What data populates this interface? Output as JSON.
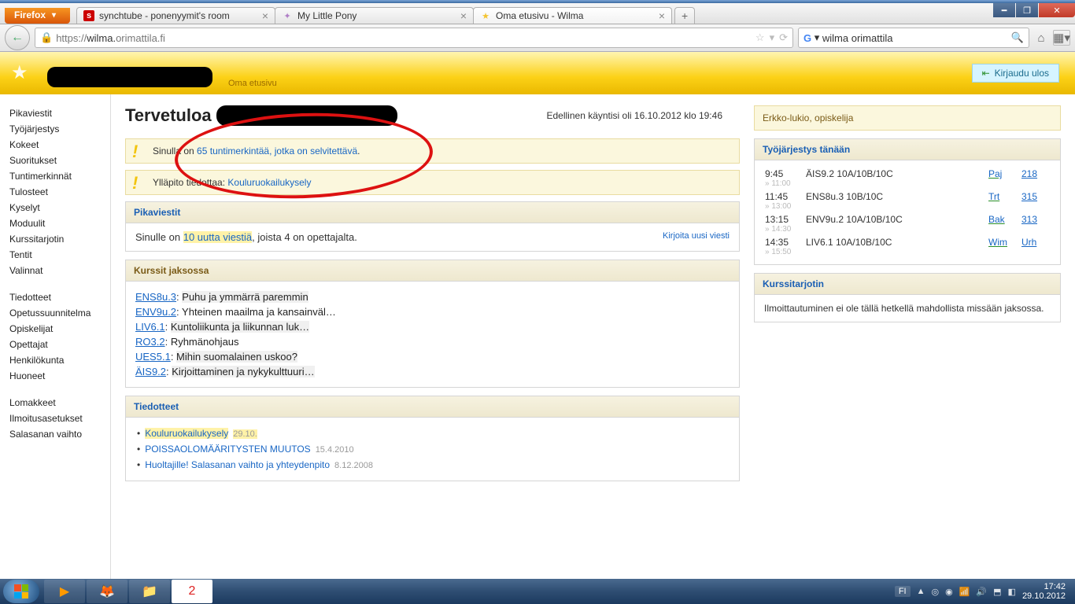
{
  "browser": {
    "name": "Firefox",
    "tabs": [
      {
        "title": "synchtube - ponenyymit's room"
      },
      {
        "title": "My Little Pony"
      },
      {
        "title": "Oma etusivu - Wilma"
      }
    ],
    "url_prefix": "https://",
    "url_host": "wilma.",
    "url_suffix": "orimattila.fi",
    "search_value": "wilma orimattila"
  },
  "header": {
    "breadcrumb": "Oma etusivu",
    "logout": "Kirjaudu ulos"
  },
  "sidebar": {
    "groups": [
      [
        "Pikaviestit",
        "Työjärjestys",
        "Kokeet",
        "Suoritukset",
        "Tuntimerkinnät",
        "Tulosteet",
        "Kyselyt",
        "Moduulit",
        "Kurssitarjotin",
        "Tentit",
        "Valinnat"
      ],
      [
        "Tiedotteet",
        "Opetussuunnitelma",
        "Opiskelijat",
        "Opettajat",
        "Henkilökunta",
        "Huoneet"
      ],
      [
        "Lomakkeet",
        "Ilmoitusasetukset",
        "Salasanan vaihto"
      ]
    ]
  },
  "page": {
    "welcome": "Tervetuloa",
    "last_visit": "Edellinen käyntisi oli 16.10.2012 klo 19:46",
    "alert1_prefix": "Sinulla on ",
    "alert1_link": "65 tuntimerkintää, jotka on selvitettävä",
    "alert1_suffix": ".",
    "alert2_prefix": "Ylläpito tiedottaa: ",
    "alert2_link": "Kouluruokailukysely",
    "msgs_head": "Pikaviestit",
    "msgs_prefix": "Sinulle on ",
    "msgs_count": "10 uutta viestiä",
    "msgs_suffix": ", joista 4 on opettajalta.",
    "msgs_write": "Kirjoita uusi viesti",
    "courses_head": "Kurssit jaksossa",
    "courses": [
      {
        "code": "ENS8u.3",
        "desc": "Puhu ja ymmärrä paremmin",
        "sel": true
      },
      {
        "code": "ENV9u.2",
        "desc": "Yhteinen maailma ja kansainväl…"
      },
      {
        "code": "LIV6.1",
        "desc": "Kuntoliikunta ja liikunnan luk…",
        "sel": true
      },
      {
        "code": "RO3.2",
        "desc": "Ryhmänohjaus"
      },
      {
        "code": "UES5.1",
        "desc": "Mihin suomalainen uskoo?",
        "sel": true
      },
      {
        "code": "ÄIS9.2",
        "desc": "Kirjoittaminen ja nykykulttuuri…",
        "sel": true
      }
    ],
    "news_head": "Tiedotteet",
    "news": [
      {
        "title": "Kouluruokailukysely",
        "date": "29.10.",
        "hl": true
      },
      {
        "title": "POISSAOLOMÄÄRITYSTEN MUUTOS",
        "date": "15.4.2010"
      },
      {
        "title": "Huoltajille! Salasanan vaihto ja yhteydenpito",
        "date": "8.12.2008"
      }
    ],
    "userinfo": "Erkko-lukio, opiskelija",
    "sched_head": "Työjärjestys tänään",
    "schedule": [
      {
        "time": "9:45",
        "next": "» 11:00",
        "course": "ÄIS9.2 10A/10B/10C",
        "teacher": "Paj",
        "room": "218"
      },
      {
        "time": "11:45",
        "next": "» 13:00",
        "course": "ENS8u.3 10B/10C",
        "teacher": "Trt",
        "room": "315"
      },
      {
        "time": "13:15",
        "next": "» 14:30",
        "course": "ENV9u.2 10A/10B/10C",
        "teacher": "Bak",
        "room": "313"
      },
      {
        "time": "14:35",
        "next": "» 15:50",
        "course": "LIV6.1 10A/10B/10C",
        "teacher": "Wim",
        "room": "Urh"
      }
    ],
    "kt_head": "Kurssitarjotin",
    "kt_body": "Ilmoittautuminen ei ole tällä hetkellä mahdollista missään jaksossa."
  },
  "taskbar": {
    "lang": "FI",
    "time": "17:42",
    "date": "29.10.2012"
  }
}
